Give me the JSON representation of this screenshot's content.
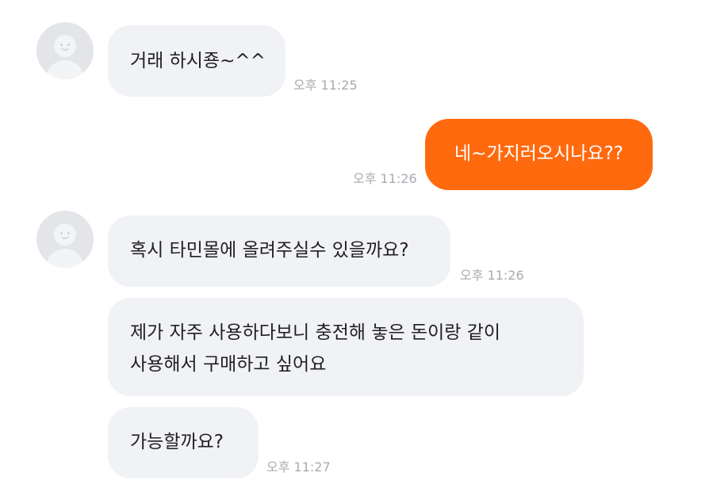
{
  "chat": {
    "messages": [
      {
        "sender": "other",
        "text": "거래 하시죵~^^",
        "time": "오후 11:25"
      },
      {
        "sender": "me",
        "text": "네~가지러오시나요??",
        "time": "오후 11:26"
      },
      {
        "sender": "other",
        "text": "혹시 타민몰에 올려주실수 있을까요?",
        "time": "오후 11:26"
      },
      {
        "sender": "other",
        "line1": "제가 자주 사용하다보니 충전해 놓은 돈이랑 같이",
        "line2": "사용해서 구매하고 싶어요"
      },
      {
        "sender": "other",
        "text": "가능할까요?",
        "time": "오후 11:27"
      }
    ]
  },
  "colors": {
    "outgoing_bubble": "#ff6a0f",
    "incoming_bubble": "#f1f2f5",
    "timestamp": "#a9aab0",
    "avatar_bg": "#e4e5e9"
  },
  "icons": {
    "avatar": "default-profile-avatar-icon"
  }
}
